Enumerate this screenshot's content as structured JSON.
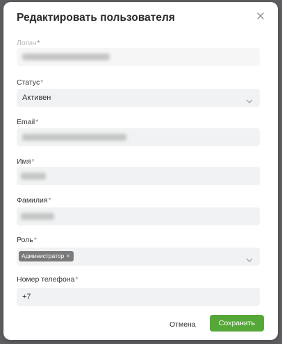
{
  "dialog": {
    "title": "Редактировать пользователя",
    "close_icon": "close-icon"
  },
  "fields": {
    "login": {
      "label": "Логин",
      "required": "*",
      "value": ""
    },
    "status": {
      "label": "Статус",
      "required": "*",
      "value": "Активен"
    },
    "email": {
      "label": "Email",
      "required": "*",
      "value": ""
    },
    "first_name": {
      "label": "Имя",
      "required": "*",
      "value": ""
    },
    "last_name": {
      "label": "Фамилия",
      "required": "*",
      "value": ""
    },
    "role": {
      "label": "Роль",
      "required": "*",
      "tag": "Администратор",
      "tag_remove": "×"
    },
    "phone": {
      "label": "Номер телефона",
      "required": "*",
      "value": "+7"
    }
  },
  "buttons": {
    "cancel": "Отмена",
    "save": "Сохранить"
  },
  "colors": {
    "accent": "#55a737",
    "overlay": "#5f6063",
    "field_bg": "#f1f2f3"
  }
}
